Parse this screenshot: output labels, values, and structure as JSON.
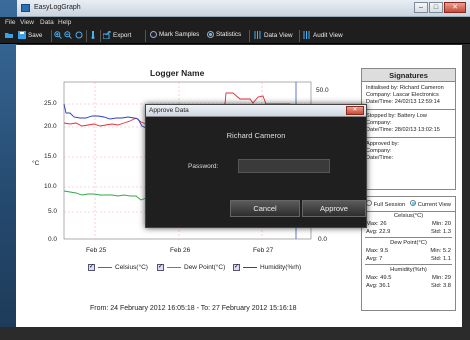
{
  "window": {
    "title": "EasyLogGraph",
    "btn_min": "–",
    "btn_max": "□",
    "btn_close": "✕"
  },
  "menu": [
    "File",
    "View",
    "Data",
    "Help"
  ],
  "toolbar": {
    "save": "Save",
    "export": "Export",
    "mark_samples": "Mark Samples",
    "statistics": "Statistics",
    "data_view": "Data View",
    "audit_view": "Audit View"
  },
  "chart": {
    "title": "Logger Name",
    "ylabel_left": "°C",
    "left_ticks": [
      "25.0",
      "20.0",
      "15.0",
      "10.0",
      "5.0",
      "0.0"
    ],
    "right_ticks": [
      "50.0",
      "0.0"
    ],
    "x_ticks": [
      "Feb 25",
      "Feb 26",
      "Feb 27"
    ],
    "legend": [
      {
        "label": "Celsius(°C)",
        "color": "#e0303a"
      },
      {
        "label": "Dew Point(°C)",
        "color": "#2da84a"
      },
      {
        "label": "Humidity(%rh)",
        "color": "#2b3fbf"
      }
    ],
    "range": "From: 24 February 2012 16:05:18  -  To: 27 February 2012 15:16:18"
  },
  "signatures": {
    "title": "Signatures",
    "initialised": [
      "Initialised by: Richard Cameron",
      "Company: Lascar Electronics",
      "Date/Time: 24/02/13 12:59:14"
    ],
    "stopped": [
      "Stopped by: Battery Low",
      "Company:",
      "Date/Time: 28/02/13 13:02:15"
    ],
    "approved": [
      "Approved by:",
      "Company:",
      "Date/Time:"
    ]
  },
  "stats": {
    "full_session": "Full Session",
    "current_view": "Current View",
    "groups": [
      {
        "title": "Celsius(°C)",
        "max": "Max: 26",
        "min": "Min: 20",
        "avg": "Avg: 22.9",
        "std": "Std: 1.3"
      },
      {
        "title": "Dew Point(°C)",
        "max": "Max: 9.5",
        "min": "Min: 5.2",
        "avg": "Avg: 7",
        "std": "Std: 1.1"
      },
      {
        "title": "Humidity(%rh)",
        "max": "Max: 49.5",
        "min": "Min: 29",
        "avg": "Avg: 36.1",
        "std": "Std: 3.8"
      }
    ]
  },
  "dialog": {
    "title": "Approve Data",
    "close": "✕",
    "name": "Richard Cameron",
    "password_label": "Password:",
    "password_value": "",
    "cancel": "Cancel",
    "approve": "Approve"
  }
}
